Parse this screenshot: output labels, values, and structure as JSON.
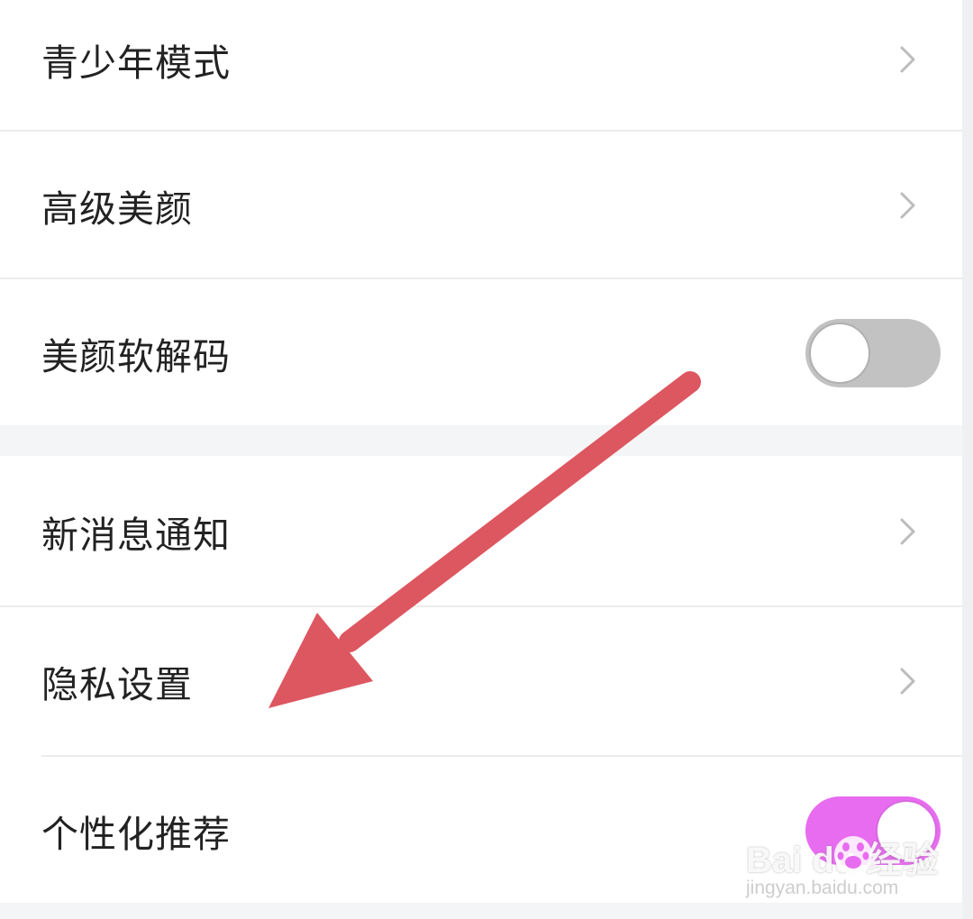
{
  "settings": {
    "items": [
      {
        "label": "青少年模式",
        "control": "chevron"
      },
      {
        "label": "高级美颜",
        "control": "chevron"
      },
      {
        "label": "美颜软解码",
        "control": "toggle",
        "state": "off"
      },
      {
        "label": "新消息通知",
        "control": "chevron"
      },
      {
        "label": "隐私设置",
        "control": "chevron"
      },
      {
        "label": "个性化推荐",
        "control": "toggle",
        "state": "on"
      }
    ]
  },
  "colors": {
    "text": "#222222",
    "toggle_off": "#c2c2c2",
    "toggle_on": "#e86cf0",
    "arrow": "#dd5760",
    "divider": "#ececec",
    "section_gap": "#f4f5f6"
  },
  "icons": {
    "chevron": "chevron-right-icon",
    "arrow": "red-arrow-annotation",
    "watermark_logo": "baidu-paw-icon"
  },
  "watermark": {
    "brand": "Bai du 经验",
    "url": "jingyan.baidu.com"
  }
}
